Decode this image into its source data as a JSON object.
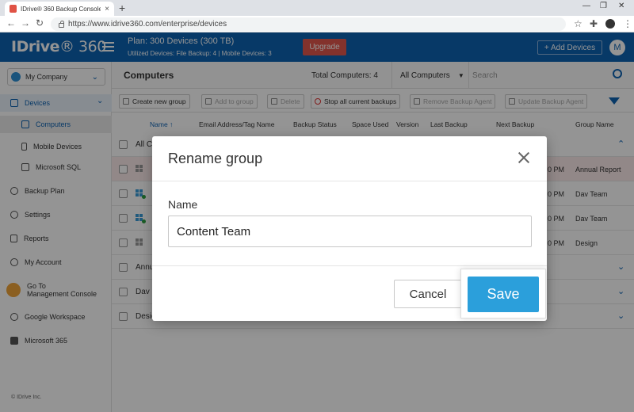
{
  "browser": {
    "tab_title": "IDrive® 360 Backup Console fo",
    "tab_close": "×",
    "new_tab": "+",
    "url": "https://www.idrive360.com/enterprise/devices",
    "win_minimize": "—",
    "win_maximize": "❐",
    "win_close": "✕",
    "back": "←",
    "forward": "→",
    "reload": "↻",
    "star": "☆",
    "extensions": "✚",
    "menu": "⋮"
  },
  "header": {
    "logo_main": "IDrive",
    "logo_sub": "® 360",
    "plan_title": "Plan: 300 Devices (300 TB)",
    "plan_sub": "Utilized Devices: File Backup: 4 |   Mobile Devices: 3",
    "upgrade_label": "Upgrade",
    "add_devices_label": "+ Add Devices",
    "avatar_letter": "M",
    "accent": "#0d62b1"
  },
  "sidebar": {
    "company": "My Company",
    "company_chevron": "⌄",
    "devices_chevron": "⌄",
    "items": [
      {
        "label": "Devices"
      },
      {
        "label": "Computers"
      },
      {
        "label": "Mobile Devices"
      },
      {
        "label": "Microsoft SQL"
      },
      {
        "label": "Backup Plan"
      },
      {
        "label": "Settings"
      },
      {
        "label": "Reports"
      },
      {
        "label": "My Account"
      },
      {
        "label": "Go To\nManagement Console"
      },
      {
        "label": "Google Workspace"
      },
      {
        "label": "Microsoft 365"
      }
    ],
    "footer": "© IDrive Inc."
  },
  "main": {
    "title": "Computers",
    "total": "Total Computers: 4",
    "filter_value": "All Computers",
    "filter_caret": "▼",
    "search_placeholder": "Search",
    "toolbar": {
      "create_group": "Create new group",
      "add_to_group": "Add to group",
      "delete": "Delete",
      "stop_backups": "Stop all current  backups",
      "remove_agent": "Remove Backup Agent",
      "update_agent": "Update Backup Agent"
    },
    "columns": {
      "name": "Name  ↑",
      "email": "Email Address/Tag Name",
      "status": "Backup Status",
      "space": "Space Used",
      "version": "Version",
      "last": "Last Backup",
      "next": "Next Backup",
      "group": "Group Name"
    },
    "rows": [
      {
        "label": "All C",
        "time": "",
        "group": "",
        "chevron": "⌃"
      },
      {
        "label": "",
        "time": "0 PM",
        "group": "Annual Report",
        "chevron": ""
      },
      {
        "label": "",
        "time": "0 PM",
        "group": "Dav Team",
        "chevron": ""
      },
      {
        "label": "",
        "time": "0 PM",
        "group": "Dav Team",
        "chevron": ""
      },
      {
        "label": "",
        "time": "0 PM",
        "group": "Design",
        "chevron": ""
      },
      {
        "label": "Annu",
        "time": "",
        "group": "",
        "chevron": "⌄"
      },
      {
        "label": "Dav",
        "time": "",
        "group": "",
        "chevron": "⌄"
      },
      {
        "label": "Desig",
        "time": "",
        "group": "",
        "chevron": "⌄"
      }
    ]
  },
  "modal": {
    "title": "Rename group",
    "name_label": "Name",
    "name_value": "Content Team",
    "cancel_label": "Cancel",
    "save_label": "Save",
    "save_color": "#2b9fdb"
  }
}
